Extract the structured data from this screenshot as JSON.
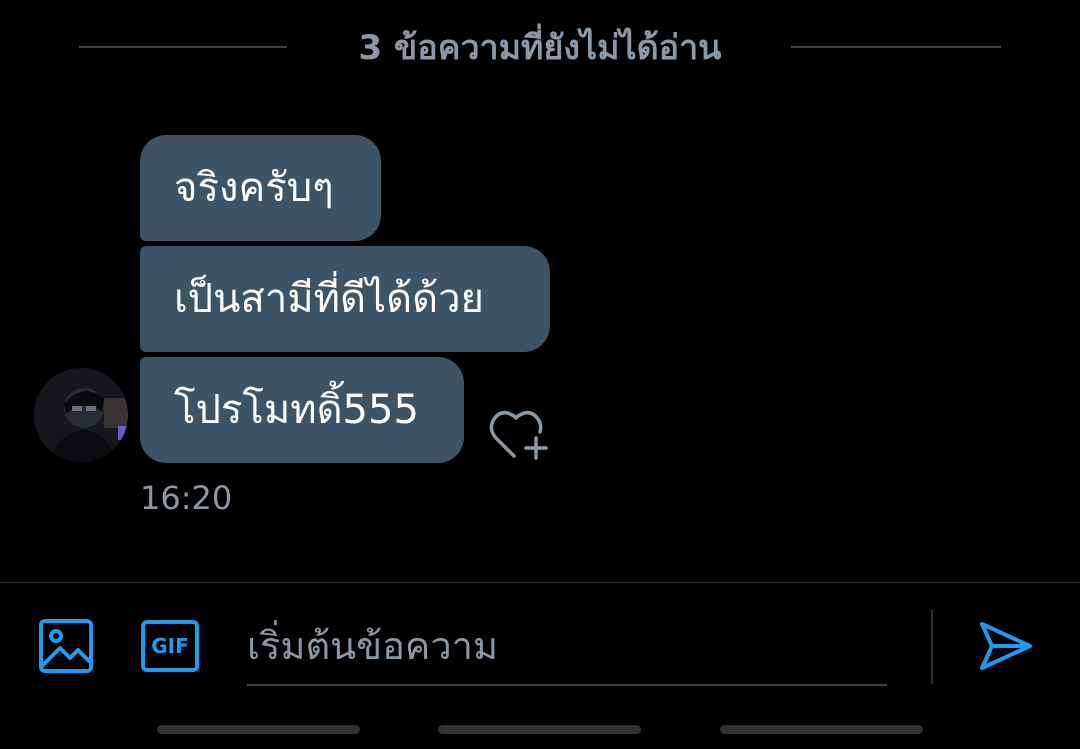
{
  "unread_divider": {
    "label": "3 ข้อความที่ยังไม่ได้อ่าน"
  },
  "messages": [
    {
      "text": "จริงครับๆ"
    },
    {
      "text": "เป็นสามีที่ดีได้ด้วย"
    },
    {
      "text": "โปรโมทดิ้555"
    }
  ],
  "last_message_time": "16:20",
  "composer": {
    "placeholder": "เริ่มต้นข้อความ",
    "gif_label": "GIF"
  },
  "icons": {
    "media": "image-icon",
    "gif": "gif-icon",
    "send": "send-icon",
    "react": "heart-plus-icon"
  },
  "colors": {
    "accent": "#1d9bf0",
    "bubble": "#3d5466",
    "muted_text": "#8b98a5",
    "background": "#000000"
  }
}
